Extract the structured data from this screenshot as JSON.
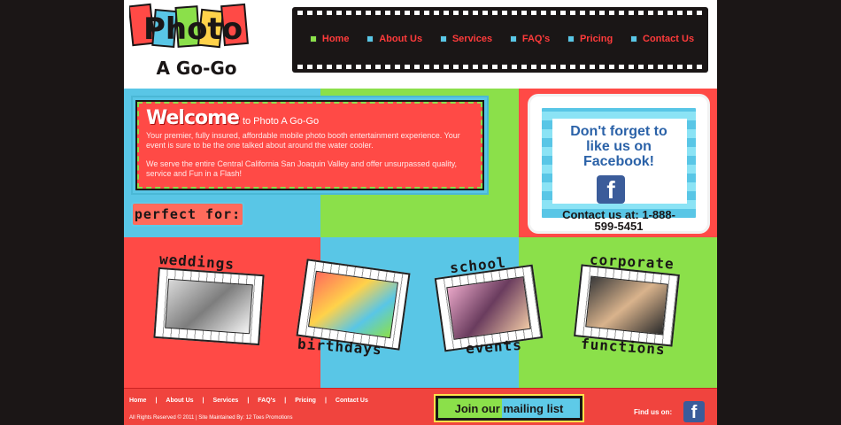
{
  "logo": {
    "line1": "Photo",
    "line2": "A Go-Go"
  },
  "nav": {
    "items": [
      {
        "label": "Home",
        "color": "#8be04a"
      },
      {
        "label": "About Us",
        "color": "#59c6e6"
      },
      {
        "label": "Services",
        "color": "#59c6e6"
      },
      {
        "label": "FAQ's",
        "color": "#59c6e6"
      },
      {
        "label": "Pricing",
        "color": "#59c6e6"
      },
      {
        "label": "Contact Us",
        "color": "#59c6e6"
      }
    ]
  },
  "welcome": {
    "big": "Welcome",
    "small": "to Photo A Go-Go",
    "p1": "Your premier, fully insured, affordable mobile photo booth entertainment experience. Your event is sure to be the one talked about around the water cooler.",
    "p2": "We serve the entire Central California San Joaquin Valley and offer unsurpassed quality, service and Fun in a Flash!"
  },
  "perfect": "perfect for:",
  "facebook_card": {
    "line1": "Don't forget to like us on Facebook!",
    "contact": "Contact us at: 1-888-599-5451"
  },
  "categories": [
    {
      "top": "weddings",
      "bottom": ""
    },
    {
      "top": "",
      "bottom": "birthdays"
    },
    {
      "top": "school",
      "bottom": "events"
    },
    {
      "top": "corporate",
      "bottom": "functions"
    }
  ],
  "footer": {
    "links": [
      "Home",
      "About Us",
      "Services",
      "FAQ's",
      "Pricing",
      "Contact Us"
    ],
    "copyright": "All Rights Reserved © 2011 | Site Maintained By: 12 Toes Promotions",
    "mailing": "Join our mailing list",
    "find_us": "Find us on:"
  },
  "colors": {
    "red": "#ff4a46",
    "blue": "#59c6e6",
    "green": "#8be04a",
    "dark": "#1a1616"
  }
}
